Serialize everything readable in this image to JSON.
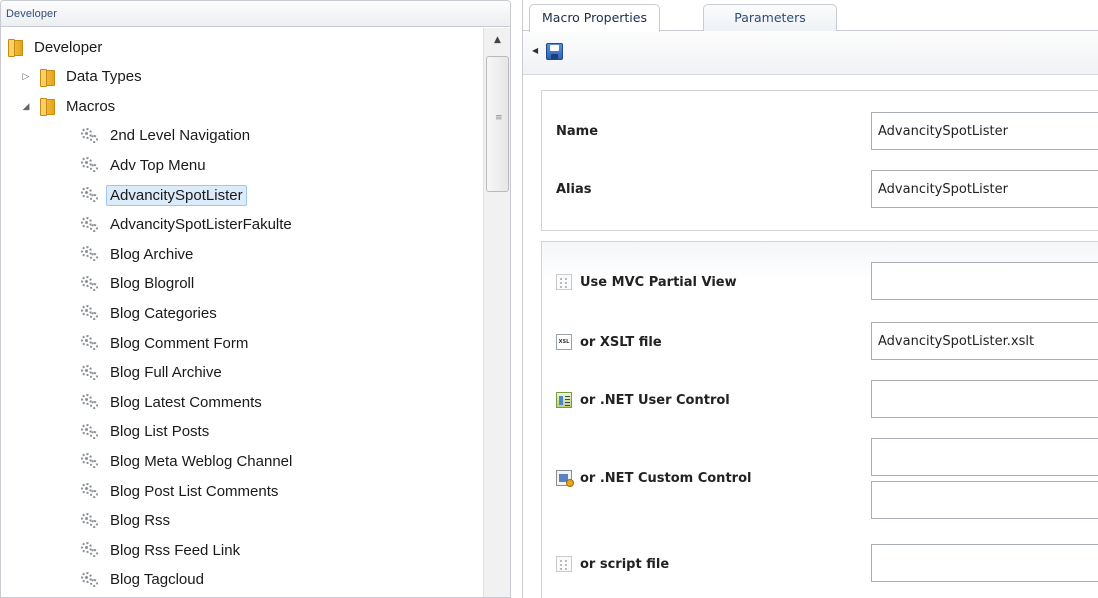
{
  "left_panel": {
    "header": "Developer",
    "tree": [
      {
        "label": "Developer",
        "level": 0,
        "type": "folder",
        "toggle": ""
      },
      {
        "label": "Data Types",
        "level": 1,
        "type": "folder",
        "toggle": "▷"
      },
      {
        "label": "Macros",
        "level": 1,
        "type": "folder",
        "toggle": "◢"
      },
      {
        "label": "2nd Level Navigation",
        "level": 2,
        "type": "macro"
      },
      {
        "label": "Adv Top Menu",
        "level": 2,
        "type": "macro"
      },
      {
        "label": "AdvancitySpotLister",
        "level": 2,
        "type": "macro",
        "selected": true
      },
      {
        "label": "AdvancitySpotListerFakulte",
        "level": 2,
        "type": "macro"
      },
      {
        "label": "Blog Archive",
        "level": 2,
        "type": "macro"
      },
      {
        "label": "Blog Blogroll",
        "level": 2,
        "type": "macro"
      },
      {
        "label": "Blog Categories",
        "level": 2,
        "type": "macro"
      },
      {
        "label": "Blog Comment Form",
        "level": 2,
        "type": "macro"
      },
      {
        "label": "Blog Full Archive",
        "level": 2,
        "type": "macro"
      },
      {
        "label": "Blog Latest Comments",
        "level": 2,
        "type": "macro"
      },
      {
        "label": "Blog List Posts",
        "level": 2,
        "type": "macro"
      },
      {
        "label": "Blog Meta Weblog Channel",
        "level": 2,
        "type": "macro"
      },
      {
        "label": "Blog Post List Comments",
        "level": 2,
        "type": "macro"
      },
      {
        "label": "Blog Rss",
        "level": 2,
        "type": "macro"
      },
      {
        "label": "Blog Rss Feed Link",
        "level": 2,
        "type": "macro"
      },
      {
        "label": "Blog Tagcloud",
        "level": 2,
        "type": "macro"
      }
    ]
  },
  "right_panel": {
    "tabs": [
      {
        "label": "Macro Properties",
        "active": true
      },
      {
        "label": "Parameters",
        "active": false
      }
    ],
    "toolbar": {
      "collapse_icon": "triangle-left-icon",
      "save_icon": "floppy-disk-icon"
    },
    "properties": {
      "name_label": "Name",
      "name_value": "AdvancitySpotLister",
      "alias_label": "Alias",
      "alias_value": "AdvancitySpotLister"
    },
    "sources": {
      "mvc_label": "Use MVC Partial View",
      "mvc_value": "",
      "xslt_label": "or XSLT file",
      "xslt_value": "AdvancitySpotLister.xslt",
      "xslt_icon_text": "XSL",
      "usercontrol_label": "or .NET User Control",
      "usercontrol_value": "",
      "customcontrol_label": "or .NET Custom Control",
      "customcontrol_value_1": "",
      "customcontrol_value_2": "",
      "script_label": "or script file",
      "script_value": ""
    }
  },
  "colors": {
    "selection_bg": "#dcebfa",
    "selection_border": "#9ec6ee",
    "tab_text": "#2f4d78",
    "border": "#c8ccd2"
  }
}
